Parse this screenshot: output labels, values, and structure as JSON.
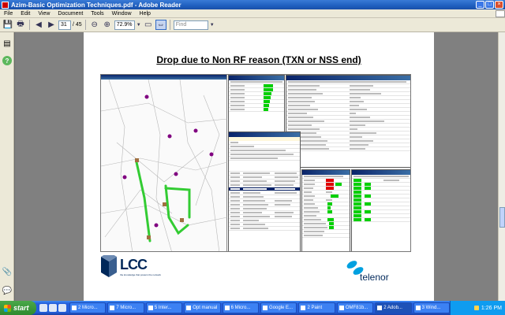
{
  "window": {
    "title": "Azim-Basic Optimization Techniques.pdf - Adobe Reader",
    "buttons": [
      "_",
      "□",
      "×"
    ]
  },
  "menu": [
    "File",
    "Edit",
    "View",
    "Document",
    "Tools",
    "Window",
    "Help"
  ],
  "toolbar": {
    "page_current": "31",
    "page_total": "/ 45",
    "zoom": "72.9%",
    "find_placeholder": "Find"
  },
  "slide": {
    "title": "Drop due to Non RF reason (TXN or NSS end)",
    "lcc_logo": "LCC",
    "lcc_tagline": "the knowledge that powers the network",
    "telenor_logo": "telenor"
  },
  "taskbar": {
    "start": "start",
    "tasks": [
      "2 Micro...",
      "7 Micro...",
      "5 Inter...",
      "Opt manual",
      "6 Micro...",
      "Google E...",
      "2 Paint",
      "OMF81b...",
      "2 Adob...",
      "3 Wind..."
    ],
    "active_task_index": 8,
    "clock": "1:26 PM"
  },
  "colors": {
    "titlebar": "#245edb",
    "route_green": "#33cc33",
    "telenor_blue": "#00a0e0",
    "lcc_navy": "#00285a"
  }
}
